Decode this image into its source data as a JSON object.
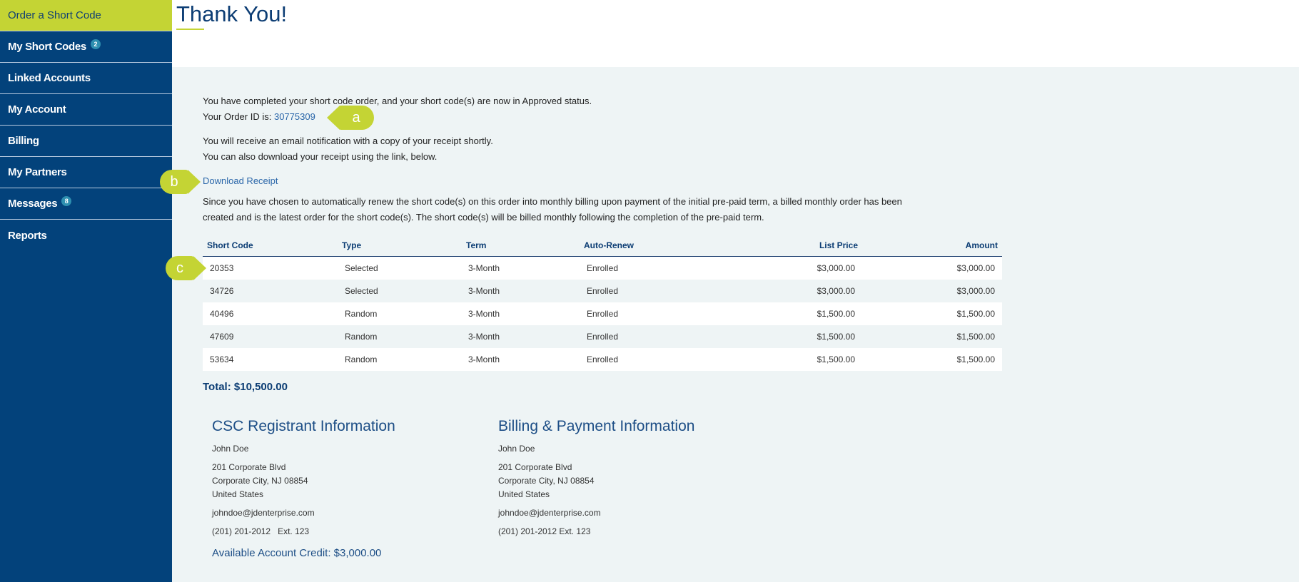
{
  "sidebar": {
    "items": [
      {
        "label": "Order a Short Code",
        "active": true
      },
      {
        "label": "My Short Codes",
        "badge": "2"
      },
      {
        "label": "Linked Accounts"
      },
      {
        "label": "My Account"
      },
      {
        "label": "Billing"
      },
      {
        "label": "My Partners"
      },
      {
        "label": "Messages",
        "badge": "8"
      },
      {
        "label": "Reports"
      }
    ]
  },
  "header": {
    "title": "Thank You!"
  },
  "confirmation": {
    "completed_text": "You have completed your short code order, and your short code(s) are now in Approved status.",
    "order_id_label": "Your Order ID is:",
    "order_id": "30775309",
    "email_text": "You will receive an email notification with a copy of your receipt shortly.",
    "download_hint": "You can also download your receipt using the link, below.",
    "download_link": "Download Receipt",
    "renew_line1": "Since you have chosen to automatically renew the short code(s) on this order into monthly billing upon payment of the initial pre-paid term, a billed monthly order has been",
    "renew_line2": "created and is the latest order for the short code(s). The short code(s) will be billed monthly following the completion of the pre-paid term."
  },
  "callouts": {
    "a": "a",
    "b": "b",
    "c": "c"
  },
  "table": {
    "headers": {
      "short_code": "Short Code",
      "type": "Type",
      "term": "Term",
      "auto_renew": "Auto-Renew",
      "list_price": "List Price",
      "amount": "Amount"
    },
    "rows": [
      {
        "short_code": "20353",
        "type": "Selected",
        "term": "3-Month",
        "auto_renew": "Enrolled",
        "list_price": "$3,000.00",
        "amount": "$3,000.00"
      },
      {
        "short_code": "34726",
        "type": "Selected",
        "term": "3-Month",
        "auto_renew": "Enrolled",
        "list_price": "$3,000.00",
        "amount": "$3,000.00"
      },
      {
        "short_code": "40496",
        "type": "Random",
        "term": "3-Month",
        "auto_renew": "Enrolled",
        "list_price": "$1,500.00",
        "amount": "$1,500.00"
      },
      {
        "short_code": "47609",
        "type": "Random",
        "term": "3-Month",
        "auto_renew": "Enrolled",
        "list_price": "$1,500.00",
        "amount": "$1,500.00"
      },
      {
        "short_code": "53634",
        "type": "Random",
        "term": "3-Month",
        "auto_renew": "Enrolled",
        "list_price": "$1,500.00",
        "amount": "$1,500.00"
      }
    ],
    "total": "Total:  $10,500.00"
  },
  "registrant": {
    "title": "CSC Registrant Information",
    "name": "John Doe",
    "address1": "201 Corporate Blvd",
    "address2": "Corporate City, NJ 08854",
    "country": "United States",
    "email": "johndoe@jdenterprise.com",
    "phone": "(201) 201-2012   Ext. 123",
    "credit": "Available Account Credit: $3,000.00"
  },
  "billing": {
    "title": "Billing & Payment Information",
    "name": "John Doe",
    "address1": "201 Corporate Blvd",
    "address2": "Corporate City, NJ 08854",
    "country": "United States",
    "email": "johndoe@jdenterprise.com",
    "phone": "(201) 201-2012 Ext. 123"
  },
  "colors": {
    "sidebar_bg": "#03427b",
    "accent_green": "#c4d434",
    "link_blue": "#2a66a9",
    "heading_blue": "#0c3d74",
    "content_bg": "#eef4f5"
  }
}
